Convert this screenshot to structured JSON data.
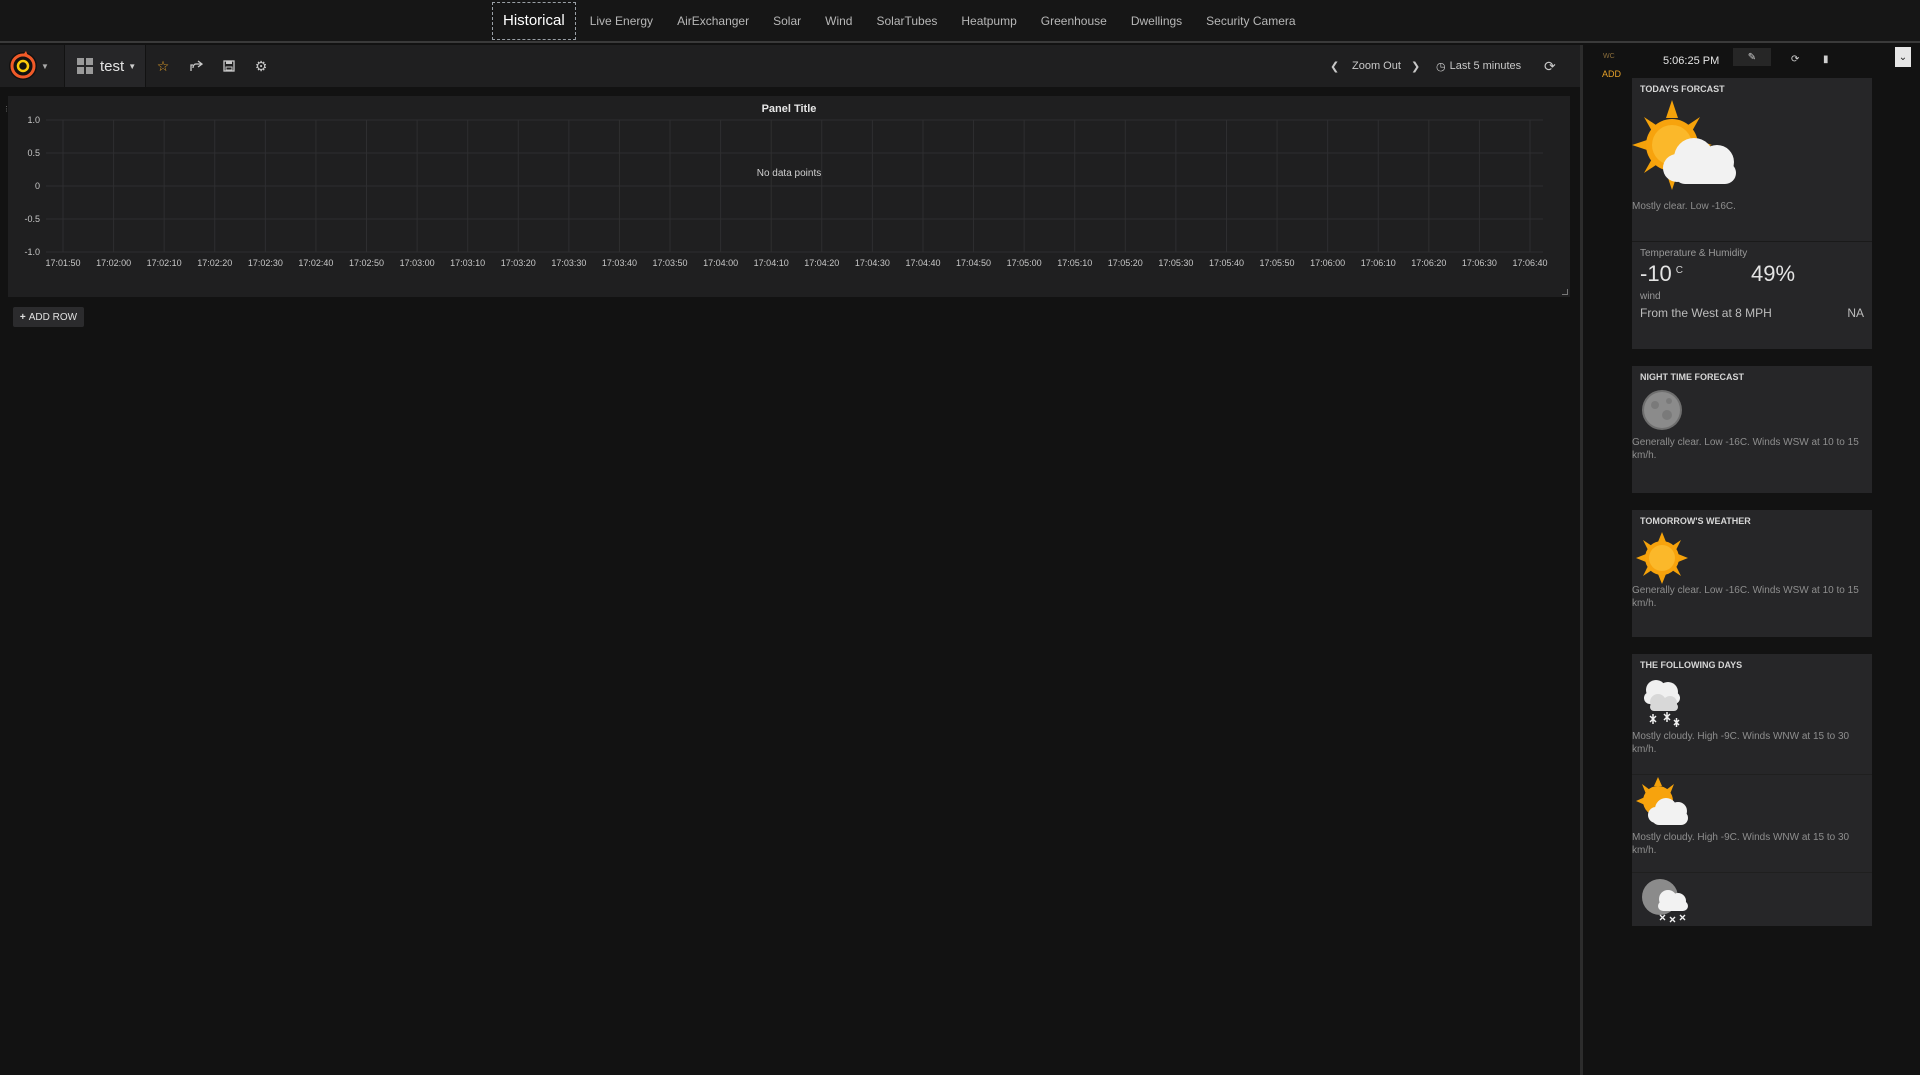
{
  "topnav": {
    "tabs": [
      "Historical",
      "Live Energy",
      "AirExchanger",
      "Solar",
      "Wind",
      "SolarTubes",
      "Heatpump",
      "Greenhouse",
      "Dwellings",
      "Security Camera"
    ],
    "active": "Historical"
  },
  "dashboard": {
    "title": "test",
    "zoom_out_label": "Zoom Out",
    "time_range_label": "Last 5 minutes",
    "add_row_label": "ADD ROW"
  },
  "panel": {
    "title": "Panel Title",
    "empty_message": "No data points"
  },
  "chart_data": {
    "type": "line",
    "title": "Panel Title",
    "series": [],
    "y_ticks": [
      "1.0",
      "0.5",
      "0",
      "-0.5",
      "-1.0"
    ],
    "ylim": [
      -1.0,
      1.0
    ],
    "x_ticks": [
      "17:01:50",
      "17:02:00",
      "17:02:10",
      "17:02:20",
      "17:02:30",
      "17:02:40",
      "17:02:50",
      "17:03:00",
      "17:03:10",
      "17:03:20",
      "17:03:30",
      "17:03:40",
      "17:03:50",
      "17:04:00",
      "17:04:10",
      "17:04:20",
      "17:04:30",
      "17:04:40",
      "17:04:50",
      "17:05:00",
      "17:05:10",
      "17:05:20",
      "17:05:30",
      "17:05:40",
      "17:05:50",
      "17:06:00",
      "17:06:10",
      "17:06:20",
      "17:06:30",
      "17:06:40"
    ],
    "grid": true,
    "annotation": "No data points"
  },
  "sidebar": {
    "wc_label": "WC",
    "add_label": "ADD",
    "time": "5:06:25 PM",
    "today": {
      "title": "TODAY'S FORCAST",
      "description": "Mostly clear. Low -16C.",
      "temp_humidity_label": "Temperature & Humidity",
      "temperature": "-10",
      "temp_unit": "C",
      "humidity": "49%",
      "wind_label": "wind",
      "wind_text": "From the West at 8 MPH",
      "wind_extra": "NA"
    },
    "night": {
      "title": "NIGHT TIME FORECAST",
      "description": "Generally clear. Low -16C. Winds WSW at 10 to 15 km/h."
    },
    "tomorrow": {
      "title": "TOMORROW'S WEATHER",
      "description": "Generally clear. Low -16C. Winds WSW at 10 to 15 km/h."
    },
    "following": {
      "title": "THE FOLLOWING DAYS",
      "days": [
        {
          "icon": "snow-cloud-icon",
          "description": "Mostly cloudy. High -9C. Winds WNW at 15 to 30 km/h."
        },
        {
          "icon": "sun-cloud-icon",
          "description": "Mostly cloudy. High -9C. Winds WNW at 15 to 30 km/h."
        },
        {
          "icon": "moon-snow-cloud-icon",
          "description": ""
        }
      ]
    }
  },
  "colors": {
    "background": "#121212",
    "panel": "#1f1f20",
    "card": "#262628",
    "sun": "#f5a20a",
    "star": "#e5a028"
  }
}
